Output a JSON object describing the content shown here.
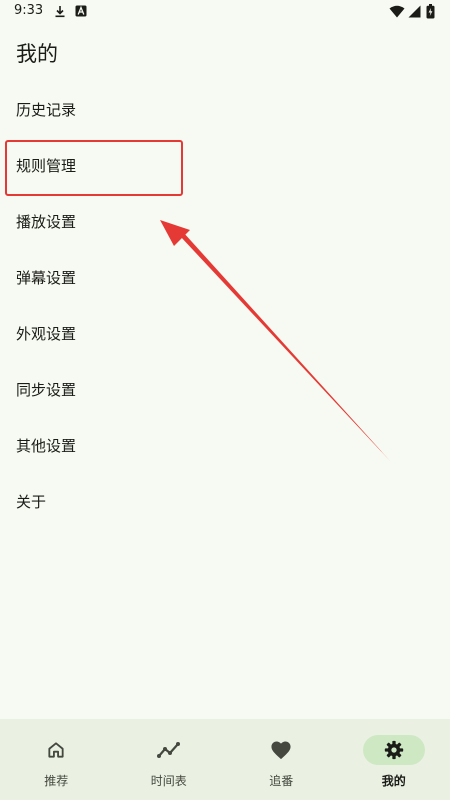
{
  "status_bar": {
    "time": "9:33",
    "icons": [
      "download-icon",
      "a-badge-icon",
      "wifi-icon",
      "cell-signal-icon",
      "battery-icon"
    ]
  },
  "header": {
    "title": "我的"
  },
  "menu": {
    "items": [
      {
        "label": "历史记录"
      },
      {
        "label": "规则管理"
      },
      {
        "label": "播放设置"
      },
      {
        "label": "弹幕设置"
      },
      {
        "label": "外观设置"
      },
      {
        "label": "同步设置"
      },
      {
        "label": "其他设置"
      },
      {
        "label": "关于"
      }
    ]
  },
  "annotation": {
    "highlight_color": "#e53935",
    "highlighted_item": "规则管理"
  },
  "bottom_nav": {
    "items": [
      {
        "label": "推荐",
        "icon": "home-icon",
        "active": false
      },
      {
        "label": "时间表",
        "icon": "timeline-icon",
        "active": false
      },
      {
        "label": "追番",
        "icon": "heart-icon",
        "active": false
      },
      {
        "label": "我的",
        "icon": "gear-icon",
        "active": true
      }
    ]
  },
  "colors": {
    "background": "#f7faf2",
    "nav_background": "#eaf0e2",
    "nav_active_pill": "#cfe8c4",
    "text": "#1b1c18"
  }
}
